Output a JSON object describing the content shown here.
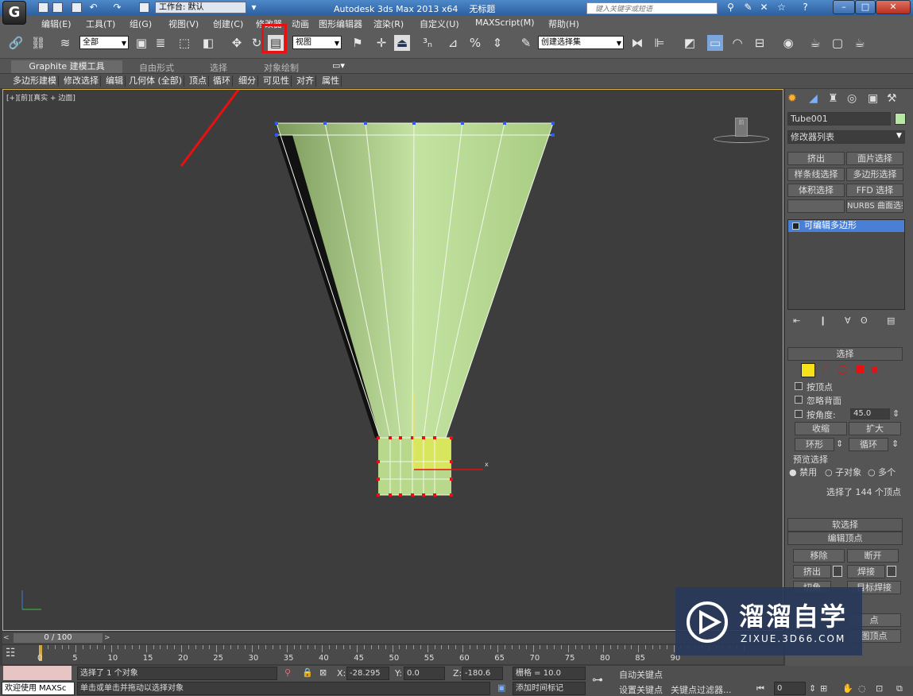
{
  "titlebar": {
    "workspace_label": "工作台: 默认",
    "app_title": "Autodesk 3ds Max  2013 x64",
    "document_title": "无标题",
    "search_placeholder": "键入关键字或短语",
    "minimize": "–",
    "maximize": "□",
    "close": "✕"
  },
  "menu": [
    "编辑(E)",
    "工具(T)",
    "组(G)",
    "视图(V)",
    "创建(C)",
    "修改器",
    "动画",
    "图形编辑器",
    "渲染(R)",
    "自定义(U)",
    "MAXScript(M)",
    "帮助(H)"
  ],
  "toolbar": {
    "selection_filter": "全部",
    "ref_coord": "视图",
    "named_selection": "创建选择集"
  },
  "ribbon": {
    "tabs": [
      "Graphite 建模工具",
      "自由形式",
      "选择",
      "对象绘制"
    ],
    "panels": [
      "多边形建模",
      "修改选择",
      "编辑",
      "几何体 (全部)",
      "顶点",
      "循环",
      "细分",
      "可见性",
      "对齐",
      "属性"
    ]
  },
  "viewport": {
    "label": "[+][前][真实 + 边面]",
    "viewcube_label": "前"
  },
  "command_panel": {
    "object_name": "Tube001",
    "modifier_list": "修改器列表",
    "modifier_buttons": [
      "挤出",
      "面片选择",
      "样条线选择",
      "多边形选择",
      "体积选择",
      "FFD 选择",
      "",
      "NURBS 曲面选择"
    ],
    "stack_item": "可编辑多边形",
    "rollout_selection": "选择",
    "by_vertex": "按顶点",
    "ignore_backfacing": "忽略背面",
    "by_angle": "按角度:",
    "angle_value": "45.0",
    "shrink": "收缩",
    "grow": "扩大",
    "ring": "环形",
    "loop": "循环",
    "preview_selection": "预览选择",
    "preview_options": [
      "禁用",
      "子对象",
      "多个"
    ],
    "selection_status": "选择了 144 个顶点",
    "soft_selection": "软选择",
    "edit_vertices": "编辑顶点",
    "remove": "移除",
    "break": "断开",
    "extrude": "挤出",
    "weld": "焊接",
    "chamfer": "切角",
    "target_weld": "目标焊接",
    "connect_partial": "点",
    "used_vertices_partial": "图顶点"
  },
  "timeline": {
    "slider_label": "0 / 100",
    "ticks": [
      0,
      5,
      10,
      15,
      20,
      25,
      30,
      35,
      40,
      45,
      50,
      55,
      60,
      65,
      70,
      75,
      80,
      85,
      90
    ]
  },
  "status": {
    "maxscript_label": "欢迎使用 MAXSc",
    "selected": "选择了 1 个对象",
    "prompt": "单击或单击并拖动以选择对象",
    "x_label": "X:",
    "x_value": "-28.295",
    "y_label": "Y:",
    "y_value": "0.0",
    "z_label": "Z:",
    "z_value": "-180.6",
    "grid": "栅格 = 10.0",
    "auto_key": "自动关键点",
    "set_key": "设置关键点",
    "add_time_tag": "添加时间标记",
    "key_filters": "关键点过滤器...",
    "frame": "0"
  },
  "watermark": {
    "brand": "溜溜自学",
    "url": "ZIXUE.3D66.COM"
  },
  "colors": {
    "selection_red": "#e81010",
    "viewport_border": "#d8b04a",
    "mesh_green": "#b5d98f"
  }
}
